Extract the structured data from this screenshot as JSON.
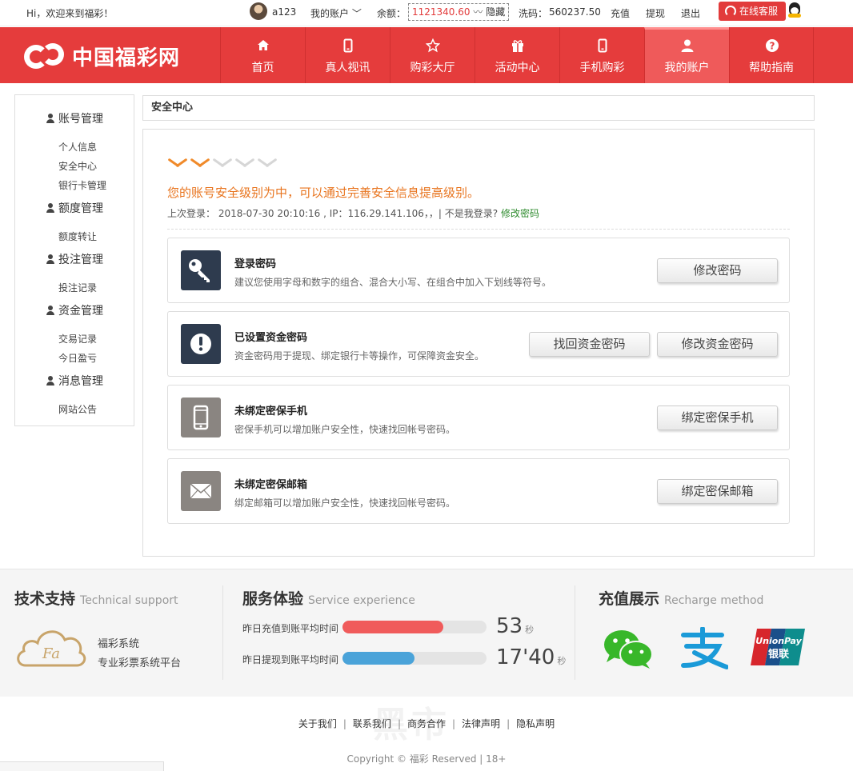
{
  "topbar": {
    "welcome": "Hi，欢迎来到福彩！",
    "username": "a123",
    "my_account": "我的账户",
    "balance_label": "余额：",
    "balance_value": "1121340.60",
    "hide_label": "隐藏",
    "wash_label": "洗码：",
    "wash_value": "560237.50",
    "recharge": "充值",
    "withdraw": "提现",
    "logout": "退出",
    "support": "在线客服"
  },
  "header": {
    "logo_text": "中国福彩网",
    "nav": [
      {
        "label": "首页",
        "icon": "home-icon"
      },
      {
        "label": "真人视讯",
        "icon": "phone-icon"
      },
      {
        "label": "购彩大厅",
        "icon": "star-icon"
      },
      {
        "label": "活动中心",
        "icon": "gift-icon"
      },
      {
        "label": "手机购彩",
        "icon": "mobile-icon"
      },
      {
        "label": "我的账户",
        "icon": "user-icon",
        "active": true
      },
      {
        "label": "帮助指南",
        "icon": "help-icon"
      }
    ]
  },
  "sidebar": {
    "groups": [
      {
        "title": "账号管理",
        "items": [
          "个人信息",
          "安全中心",
          "银行卡管理"
        ]
      },
      {
        "title": "额度管理",
        "items": [
          "额度转让"
        ]
      },
      {
        "title": "投注管理",
        "items": [
          "投注记录"
        ]
      },
      {
        "title": "资金管理",
        "items": [
          "交易记录",
          "今日盈亏"
        ]
      },
      {
        "title": "消息管理",
        "items": [
          "网站公告"
        ]
      }
    ]
  },
  "content": {
    "breadcrumb": "安全中心",
    "security_level_on": 2,
    "security_level_total": 5,
    "security_message": "您的账号安全级别为中，可以通过完善安全信息提高级别。",
    "last_login": "上次登录：  2018-07-30 20:10:16 , IP：116.29.141.106，，| 不是我登录?",
    "change_password_link": "修改密码",
    "cards": [
      {
        "title": "登录密码",
        "desc": "建议您使用字母和数字的组合、混合大小写、在组合中加入下划线等符号。",
        "buttons": [
          "修改密码"
        ],
        "icon": "key-icon"
      },
      {
        "title": "已设置资金密码",
        "desc": "资金密码用于提现、绑定银行卡等操作，可保障资金安全。",
        "buttons": [
          "找回资金密码",
          "修改资金密码"
        ],
        "icon": "exclamation-icon"
      },
      {
        "title": "未绑定密保手机",
        "desc": "密保手机可以增加账户安全性，快速找回帐号密码。",
        "buttons": [
          "绑定密保手机"
        ],
        "icon": "mobile-icon"
      },
      {
        "title": "未绑定密保邮箱",
        "desc": "绑定邮箱可以增加账户安全性，快速找回帐号密码。",
        "buttons": [
          "绑定密保邮箱"
        ],
        "icon": "envelope-icon"
      }
    ]
  },
  "footer": {
    "tech": {
      "title": "技术支持",
      "title_en": "Technical support",
      "logo_text": "Fa",
      "line1": "福彩系统",
      "line2": "专业彩票系统平台"
    },
    "service": {
      "title": "服务体验",
      "title_en": "Service experience",
      "rows": [
        {
          "label": "昨日充值到账平均时间",
          "value": "53",
          "unit": "秒",
          "fill": 0.7,
          "color": "#f05b5b"
        },
        {
          "label": "昨日提现到账平均时间",
          "value": "17'40",
          "unit": "秒",
          "fill": 0.5,
          "color": "#4aa3d9"
        }
      ]
    },
    "recharge": {
      "title": "充值展示",
      "title_en": "Recharge method",
      "methods": [
        "wechat-pay-icon",
        "alipay-icon",
        "unionpay-icon"
      ],
      "unionpay_text": "UnionPay",
      "unionpay_cn": "银联"
    },
    "links": [
      "关于我们",
      "联系我们",
      "商务合作",
      "法律声明",
      "隐私声明"
    ],
    "copyright": "Copyright © 福彩 Reserved | 18+",
    "watermark": "黑市"
  }
}
